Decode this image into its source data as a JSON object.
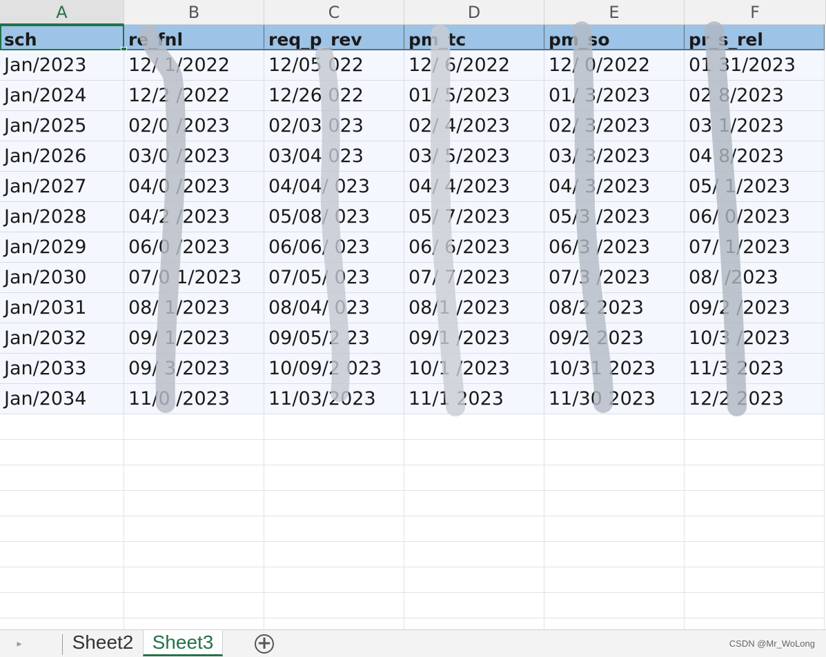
{
  "columns": [
    "A",
    "B",
    "C",
    "D",
    "E",
    "F"
  ],
  "header_cells": [
    "sch",
    "re_fnl",
    "req_p_rev",
    "pm_tc",
    "pm_so",
    "pr_s_rel"
  ],
  "rows": [
    [
      "Jan/2023",
      "12/ 1/2022",
      "12/05 022",
      "12/ 6/2022",
      "12/ 0/2022",
      "01 31/2023"
    ],
    [
      "Jan/2024",
      "12/2 /2022",
      "12/26 022",
      "01/ 5/2023",
      "01/ 3/2023",
      "02 8/2023"
    ],
    [
      "Jan/2025",
      "02/0 /2023",
      "02/03 023",
      "02/ 4/2023",
      "02/ 3/2023",
      "03 1/2023"
    ],
    [
      "Jan/2026",
      "03/0 /2023",
      "03/04 023",
      "03/ 5/2023",
      "03/ 3/2023",
      "04 8/2023"
    ],
    [
      "Jan/2027",
      "04/0 /2023",
      "04/04/ 023",
      "04/ 4/2023",
      "04/ 3/2023",
      "05/ 1/2023"
    ],
    [
      "Jan/2028",
      "04/2 /2023",
      "05/08/ 023",
      "05/ 7/2023",
      "05/3 /2023",
      "06/ 0/2023"
    ],
    [
      "Jan/2029",
      "06/0 /2023",
      "06/06/ 023",
      "06/ 6/2023",
      "06/3 /2023",
      "07/ 1/2023"
    ],
    [
      "Jan/2030",
      "07/0 1/2023",
      "07/05/ 023",
      "07/ 7/2023",
      "07/3 /2023",
      "08/ /2023"
    ],
    [
      "Jan/2031",
      "08/ 1/2023",
      "08/04/ 023",
      "08/1 /2023",
      "08/2 2023",
      "09/2 /2023"
    ],
    [
      "Jan/2032",
      "09/ 1/2023",
      "09/05/2 23",
      "09/1 /2023",
      "09/2 2023",
      "10/3 /2023"
    ],
    [
      "Jan/2033",
      "09/ 3/2023",
      "10/09/2 023",
      "10/1 /2023",
      "10/31 2023",
      "11/3 2023"
    ],
    [
      "Jan/2034",
      "11/0 /2023",
      "11/03/2023",
      "11/1 2023",
      "11/30 2023",
      "12/2 2023"
    ]
  ],
  "sheet_tabs": [
    "Sheet2",
    "Sheet3"
  ],
  "active_tab": "Sheet3",
  "watermark": "CSDN @Mr_WoLong",
  "colors": {
    "header_fill": "#9dc3e6",
    "row_fill": "#f4f7fd",
    "accent": "#217346"
  }
}
